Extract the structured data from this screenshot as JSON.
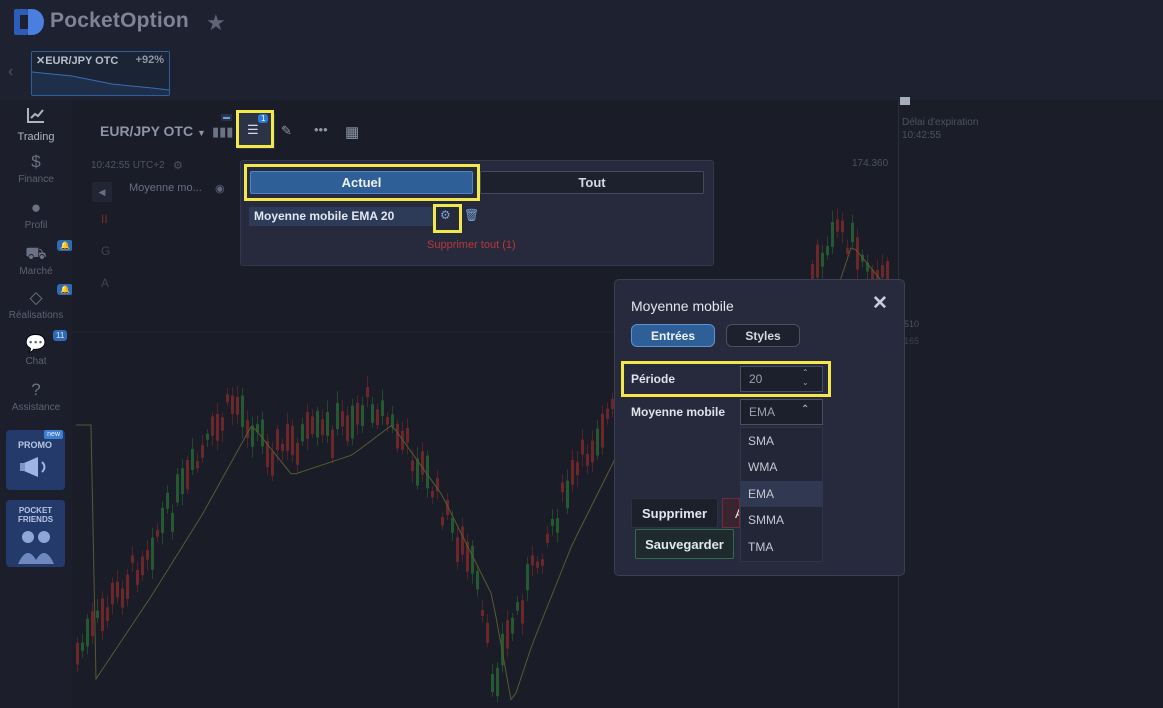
{
  "brand": {
    "name": "PocketOption"
  },
  "asset_tab": {
    "name": "EUR/JPY OTC",
    "payout": "+92%"
  },
  "sidebar": {
    "items": [
      {
        "label": "Trading",
        "icon": "chart-line-icon"
      },
      {
        "label": "Finance",
        "icon": "dollar-icon"
      },
      {
        "label": "Profil",
        "icon": "user-icon"
      },
      {
        "label": "Marché",
        "icon": "cart-icon"
      },
      {
        "label": "Réalisations",
        "icon": "diamond-icon"
      },
      {
        "label": "Chat",
        "icon": "chat-icon",
        "badge": "11"
      },
      {
        "label": "Assistance",
        "icon": "help-icon"
      }
    ],
    "promo": {
      "label": "PROMO",
      "badge": "new"
    },
    "friends": {
      "label": "POCKET FRIENDS"
    }
  },
  "toolbar": {
    "pair": "EUR/JPY OTC",
    "indicators_badge": "1"
  },
  "chart": {
    "time": "10:42:55 UTC+2",
    "indicator_label": "Moyenne mo...",
    "price_top": "174.360",
    "price_mid": "510",
    "price_mid2": "165",
    "expiry_label": "Délai d'expiration",
    "expiry_time": "10:42:55"
  },
  "indicator_panel": {
    "tabs": [
      "Actuel",
      "Tout"
    ],
    "item": "Moyenne mobile EMA 20",
    "delete_all": "Supprimer tout (1)"
  },
  "dialog": {
    "title": "Moyenne mobile",
    "tabs": [
      "Entrées",
      "Styles"
    ],
    "period_label": "Période",
    "period_value": "20",
    "ma_label": "Moyenne mobile",
    "ma_value": "EMA",
    "ma_options": [
      "SMA",
      "WMA",
      "EMA",
      "SMMA",
      "TMA"
    ],
    "delete_button": "Supprimer",
    "partial_button": "A",
    "save_button": "Sauvegarder"
  },
  "colors": {
    "highlight": "#f2e84a",
    "accent": "#2f5f97",
    "bull": "#2f8a3a",
    "bear": "#b0302f"
  }
}
